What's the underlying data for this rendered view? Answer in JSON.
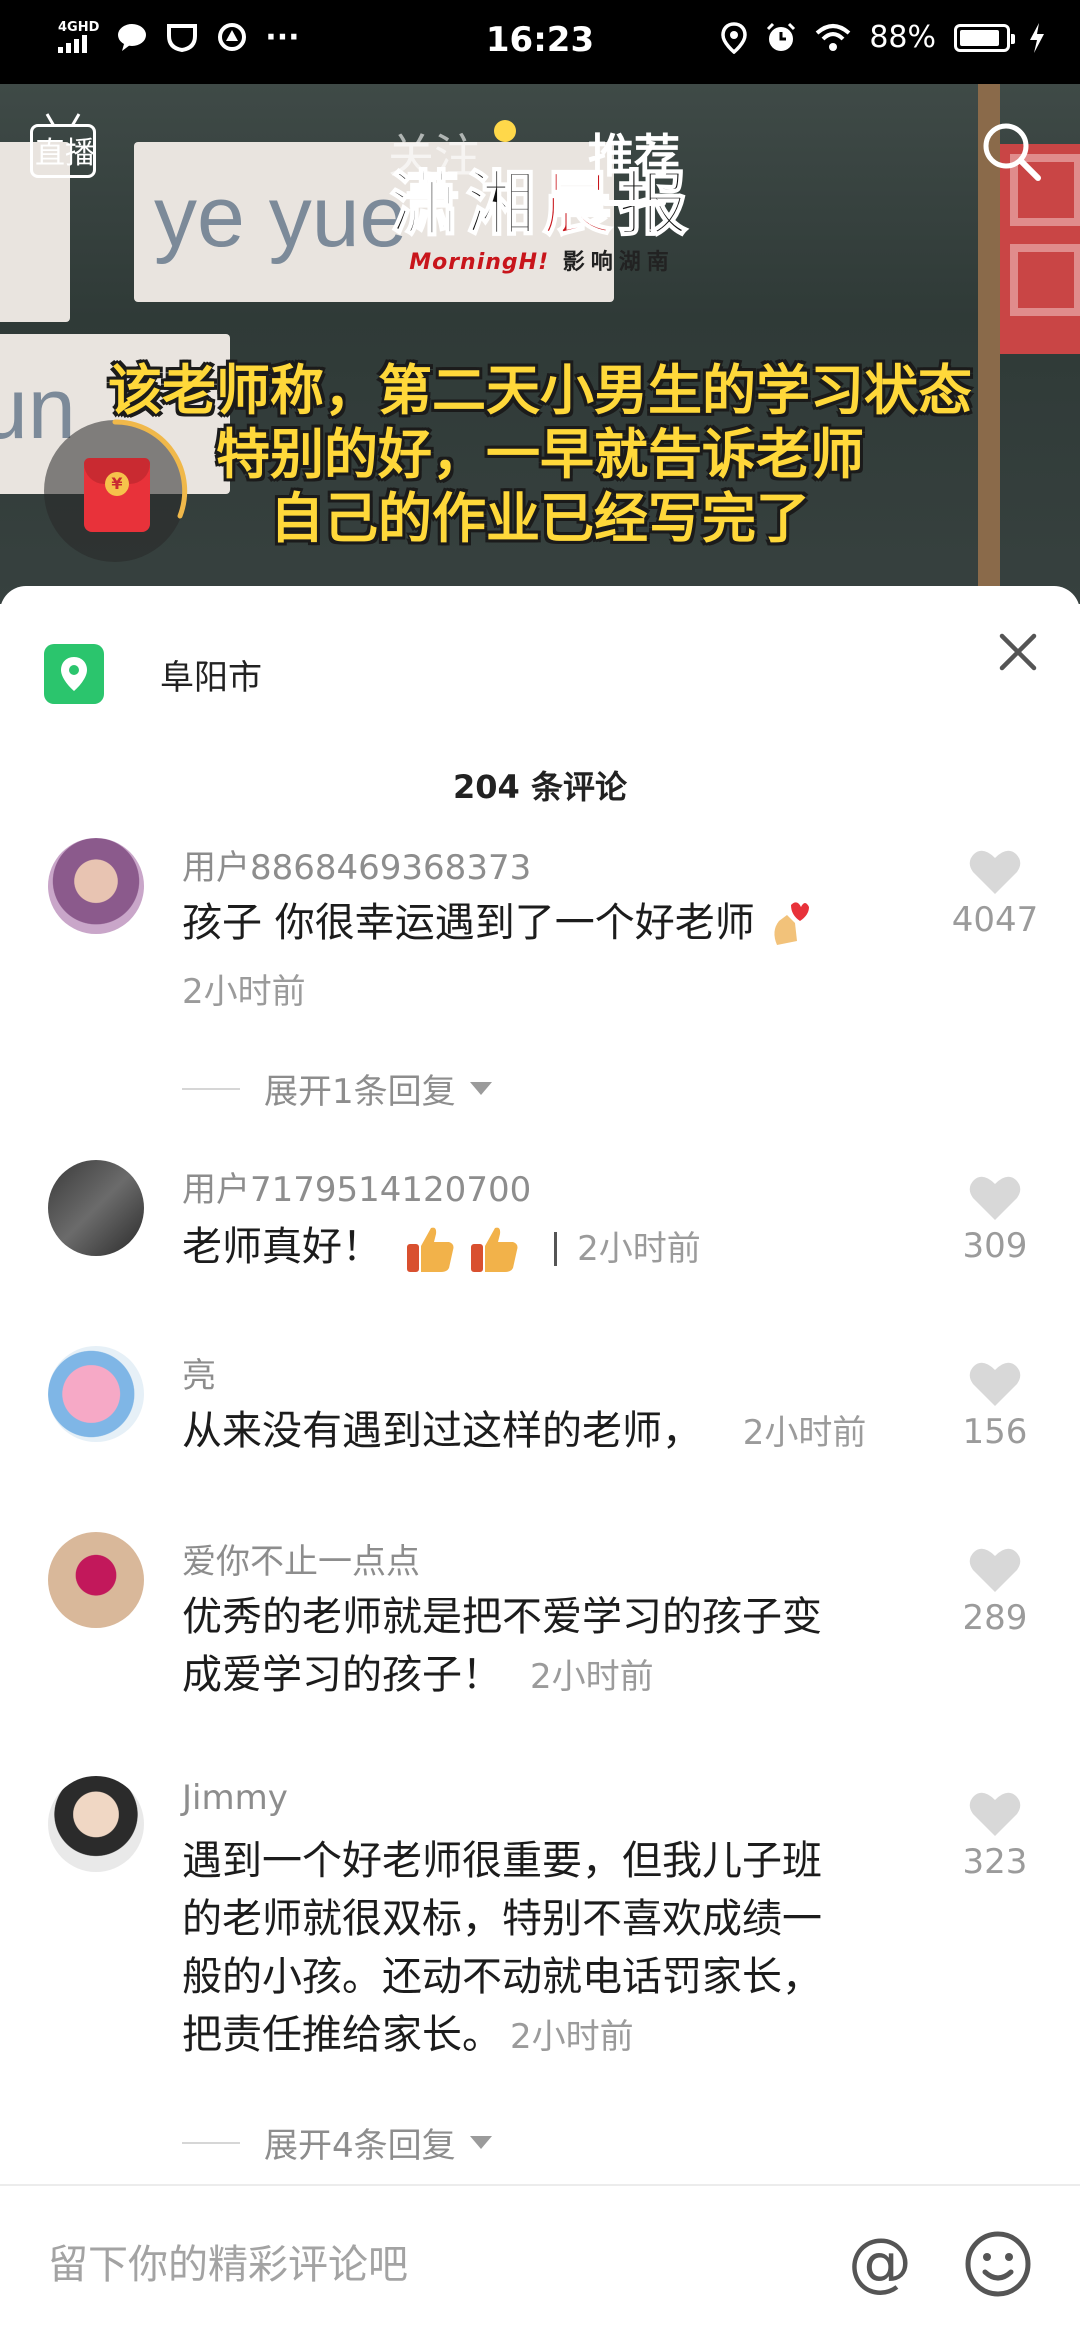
{
  "status_bar": {
    "network": "4GHD",
    "time": "16:23",
    "battery": "88%",
    "battery_level": 0.88
  },
  "top_nav": {
    "live_label": "直播",
    "tab_follow": "关注",
    "tab_recommend": "推荐"
  },
  "video": {
    "board_text": "ye yue",
    "board_text_2": "un",
    "logo_main_a": "潇湘",
    "logo_main_b": "晨",
    "logo_main_c": "报",
    "logo_sub_a": "MorningH!",
    "logo_sub_b": "影响湖南",
    "caption_lines": [
      "该老师称，第二天小男生的学习状态",
      "特别的好，一早就告诉老师",
      "自己的作业已经写完了"
    ]
  },
  "sheet": {
    "location": "阜阳市",
    "comment_count": "204 条评论"
  },
  "comments": [
    {
      "user": "用户8868469368373",
      "text": "孩子 你很幸运遇到了一个好老师",
      "time": "2小时前",
      "likes": "4047",
      "expand": "展开1条回复"
    },
    {
      "user": "用户7179514120700",
      "text": "老师真好！",
      "time": "2小时前",
      "likes": "309"
    },
    {
      "user": "亮",
      "text": "从来没有遇到过这样的老师，",
      "time": "2小时前",
      "likes": "156"
    },
    {
      "user": "爱你不止一点点",
      "text_lines": [
        "优秀的老师就是把不爱学习的孩子变",
        "成爱学习的孩子！"
      ],
      "time": "2小时前",
      "likes": "289"
    },
    {
      "user": "Jimmy",
      "text_lines": [
        "遇到一个好老师很重要，但我儿子班",
        "的老师就很双标，特别不喜欢成绩一",
        "般的小孩。还动不动就电话罚家长，",
        "把责任推给家长。"
      ],
      "time": "2小时前",
      "likes": "323",
      "expand": "展开4条回复"
    }
  ],
  "input_bar": {
    "placeholder": "留下你的精彩评论吧",
    "at_symbol": "@"
  },
  "colors": {
    "accent_green": "#2bc56d",
    "caption_yellow": "#ffd83a",
    "logo_red": "#c8151b"
  },
  "icons": [
    "wechat-icon",
    "shield-icon",
    "signal-icon",
    "location-pin-icon",
    "alarm-icon",
    "wifi-icon",
    "battery-icon",
    "charging-icon",
    "search-icon",
    "close-icon",
    "heart-icon",
    "emoji-icon",
    "thumbs-up-icon",
    "finger-heart-icon"
  ]
}
